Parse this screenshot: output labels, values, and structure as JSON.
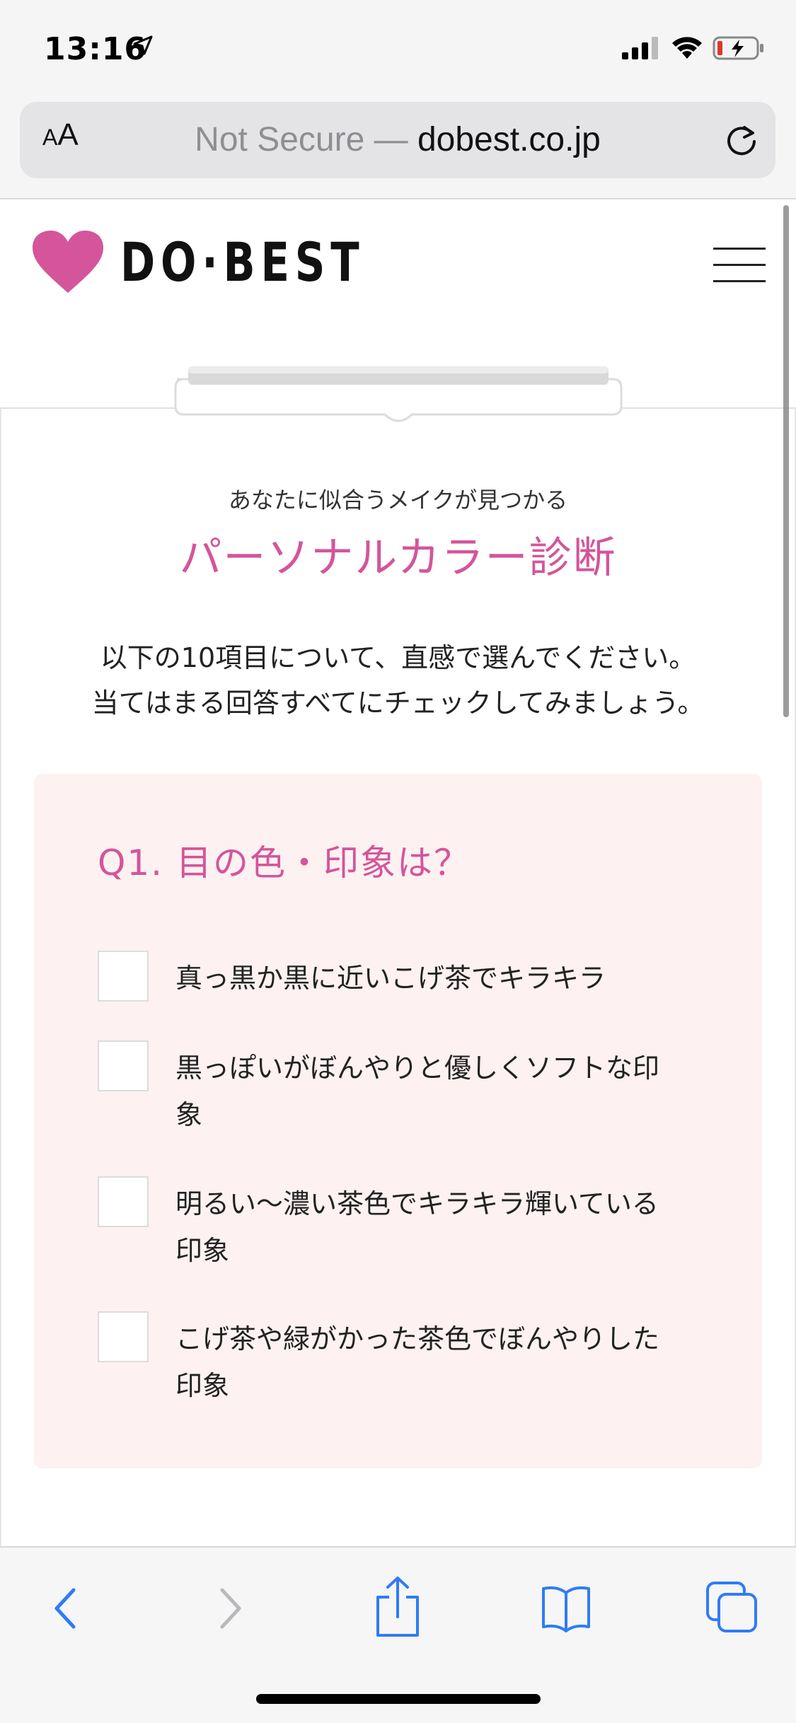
{
  "status_bar": {
    "time": "13:16"
  },
  "address_bar": {
    "aa_small": "A",
    "aa_large": "A",
    "security_label": "Not Secure —",
    "domain": "dobest.co.jp"
  },
  "site": {
    "logo_text": "DO·BEST",
    "brand_color": "#d4559a"
  },
  "page": {
    "subtitle": "あなたに似合うメイクが見つかる",
    "title": "パーソナルカラー診断",
    "intro_line1": "以下の10項目について、直感で選んでください。",
    "intro_line2": "当てはまる回答すべてにチェックしてみましょう。"
  },
  "question": {
    "title": "Q1. 目の色・印象は？",
    "options": [
      {
        "label": "真っ黒か黒に近いこげ茶でキラキラ",
        "checked": false
      },
      {
        "label": "黒っぽいがぼんやりと優しくソフトな印象",
        "checked": false
      },
      {
        "label": "明るい〜濃い茶色でキラキラ輝いている印象",
        "checked": false
      },
      {
        "label": "こげ茶や緑がかった茶色でぼんやりした印象",
        "checked": false
      }
    ]
  },
  "toolbar": {
    "accent_color": "#2f7cf6",
    "items": [
      "back-icon",
      "forward-icon",
      "share-icon",
      "bookmarks-icon",
      "tabs-icon"
    ]
  }
}
